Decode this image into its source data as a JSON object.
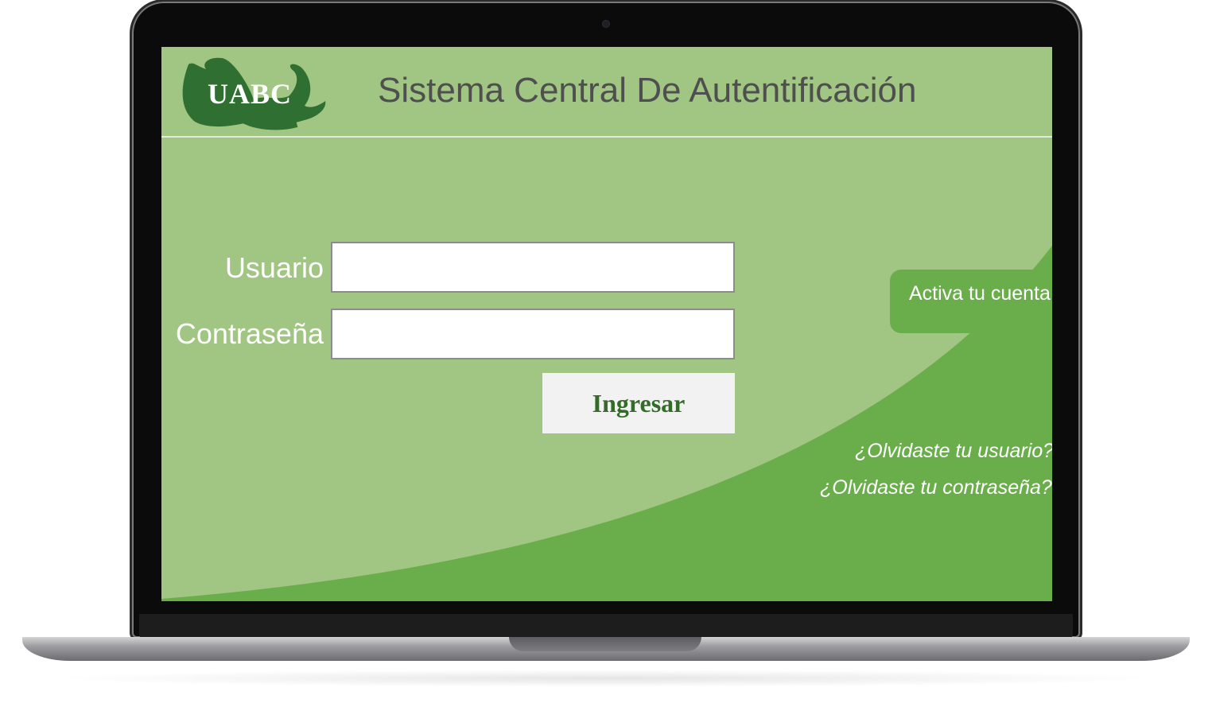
{
  "header": {
    "logo_text": "UABC",
    "title": "Sistema Central De Autentificación"
  },
  "form": {
    "username_label": "Usuario",
    "username_value": "",
    "password_label": "Contraseña",
    "password_value": "",
    "submit_label": "Ingresar"
  },
  "side": {
    "activate_label": "Activa tu cuenta",
    "forgot_user": "¿Olvidaste tu usuario?",
    "forgot_password": "¿Olvidaste tu contraseña?"
  },
  "colors": {
    "background_light_green": "#a1c583",
    "accent_green": "#6aad4b",
    "logo_green": "#2f6f31",
    "title_gray": "#4f4f4f",
    "button_text_green": "#356b2a"
  }
}
